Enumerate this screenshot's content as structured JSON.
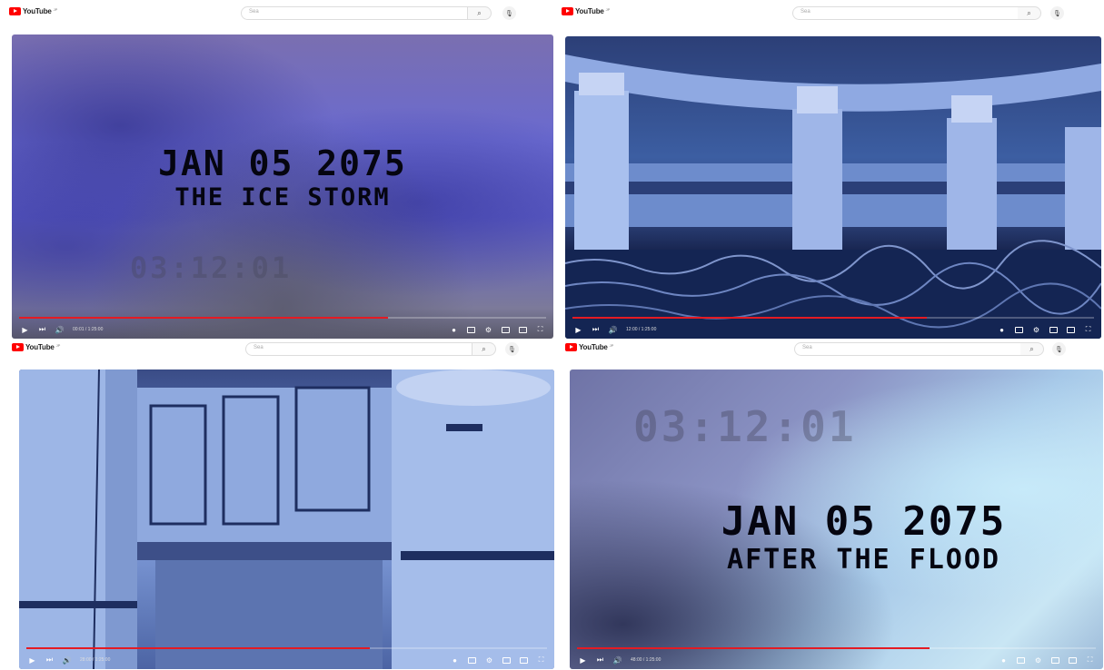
{
  "youtube": {
    "logo_text": "YouTube",
    "country_code": "JP",
    "search_placeholder": "Sea",
    "search_icon": "search-icon",
    "mic_icon": "microphone-icon"
  },
  "panes": [
    {
      "overlay_line1": "JAN 05 2075",
      "overlay_line2": "THE ICE STORM",
      "ghost_timer": "03:12:01",
      "time": "00:01 / 1:25:00",
      "progress": 0.7
    },
    {
      "time": "12:00 / 1:25:00",
      "progress": 0.68
    },
    {
      "time": "28:00 / 1:25:00",
      "progress": 0.66
    },
    {
      "overlay_line1": "JAN 05 2075",
      "overlay_line2": "AFTER THE FLOOD",
      "ghost_timer": "03:12:01",
      "time": "48:00 / 1:25:00",
      "progress": 0.68
    }
  ],
  "colors": {
    "progress_red": "#e41b23",
    "brand_red": "#ff0000"
  }
}
